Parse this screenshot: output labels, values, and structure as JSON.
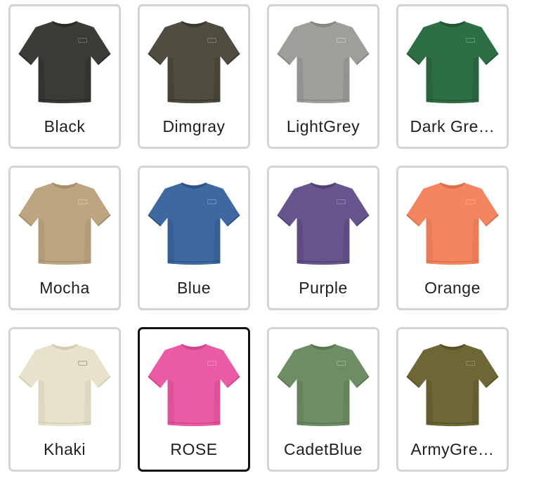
{
  "swatches": [
    {
      "label": "Black",
      "color": "#3b3b37",
      "shade": "#2a2a27",
      "logo": "#6a6a66",
      "selected": false
    },
    {
      "label": "Dimgray",
      "color": "#4f4d3f",
      "shade": "#3a392e",
      "logo": "#7d7b6c",
      "selected": false
    },
    {
      "label": "LightGrey",
      "color": "#9e9e9b",
      "shade": "#858582",
      "logo": "#c4c4c1",
      "selected": false
    },
    {
      "label": "Dark Gre…",
      "color": "#2e6e45",
      "shade": "#235735",
      "logo": "#5f9a73",
      "selected": false
    },
    {
      "label": "Mocha",
      "color": "#bea582",
      "shade": "#a68e6c",
      "logo": "#d7c5aa",
      "selected": false
    },
    {
      "label": "Blue",
      "color": "#3e69a0",
      "shade": "#2f5483",
      "logo": "#6e92c0",
      "selected": false
    },
    {
      "label": "Purple",
      "color": "#67558e",
      "shade": "#534374",
      "logo": "#8f7fb3",
      "selected": false
    },
    {
      "label": "Orange",
      "color": "#f48561",
      "shade": "#dc6e4b",
      "logo": "#f9ad93",
      "selected": false
    },
    {
      "label": "Khaki",
      "color": "#e7e2cc",
      "shade": "#d3cdb3",
      "logo": "#a8a291",
      "selected": false
    },
    {
      "label": "ROSE",
      "color": "#ea5ba5",
      "shade": "#d3468f",
      "logo": "#f28cc1",
      "selected": true
    },
    {
      "label": "CadetBlue",
      "color": "#6f8d65",
      "shade": "#5b7752",
      "logo": "#9db393",
      "selected": false
    },
    {
      "label": "ArmyGre…",
      "color": "#6c6735",
      "shade": "#58532a",
      "logo": "#948f5d",
      "selected": false
    }
  ],
  "shirt_icon": "tshirt-icon"
}
